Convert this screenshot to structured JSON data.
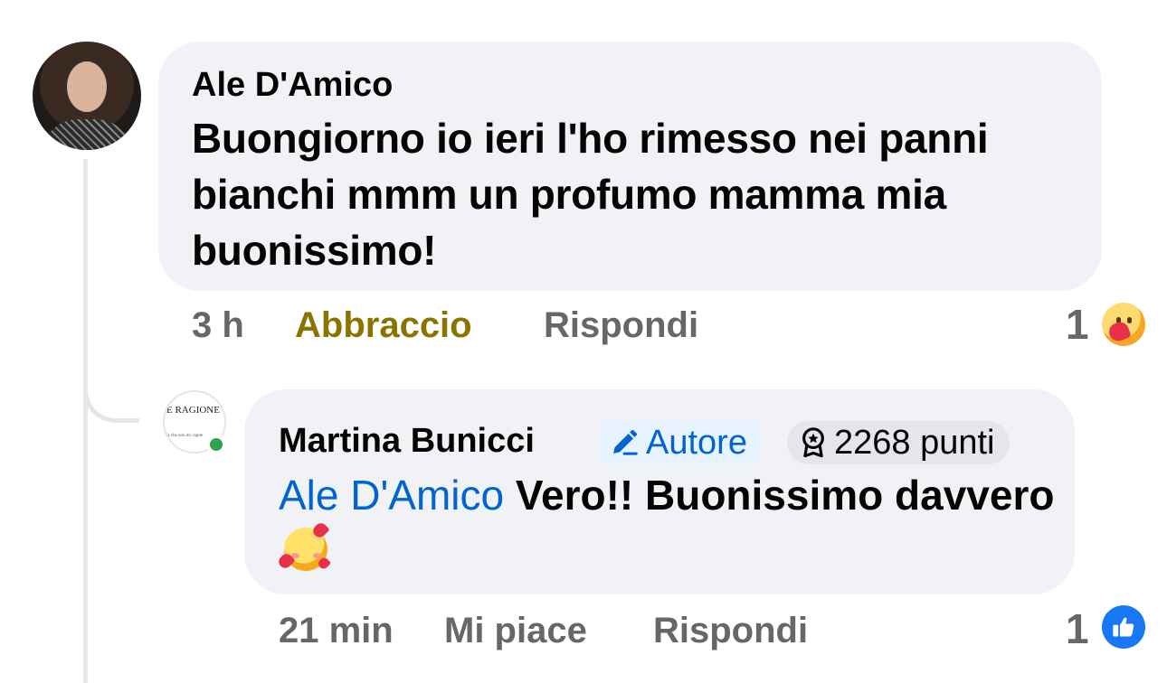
{
  "comment1": {
    "author": "Ale D'Amico",
    "text": "Buongiorno io ieri l'ho rimesso nei panni bianchi mmm un profumo mamma mia buonissimo!",
    "time": "3 h",
    "reaction_label": "Abbraccio",
    "reply_label": "Rispondi",
    "reaction_count": "1",
    "reaction_icon": "care-hug-icon"
  },
  "comment2": {
    "author": "Martina Bunicci",
    "author_badge": "Autore",
    "points_badge": "2268 punti",
    "mention": "Ale D'Amico",
    "text": "Vero!! Buonissimo davvero",
    "emoji": "smiling-face-with-hearts",
    "time": "21 min",
    "like_label": "Mi piace",
    "reply_label": "Rispondi",
    "reaction_count": "1",
    "reaction_icon": "like-thumb-icon",
    "avatar_text": "E RAGIONE 'I",
    "avatar_subtext": "la che non mi capite"
  },
  "colors": {
    "bubble": "#f0f2f5",
    "secondary_text": "#65676b",
    "link": "#0064d1",
    "hug_reaction": "#8a7400",
    "like_blue": "#1877f2",
    "online": "#31a24c"
  }
}
